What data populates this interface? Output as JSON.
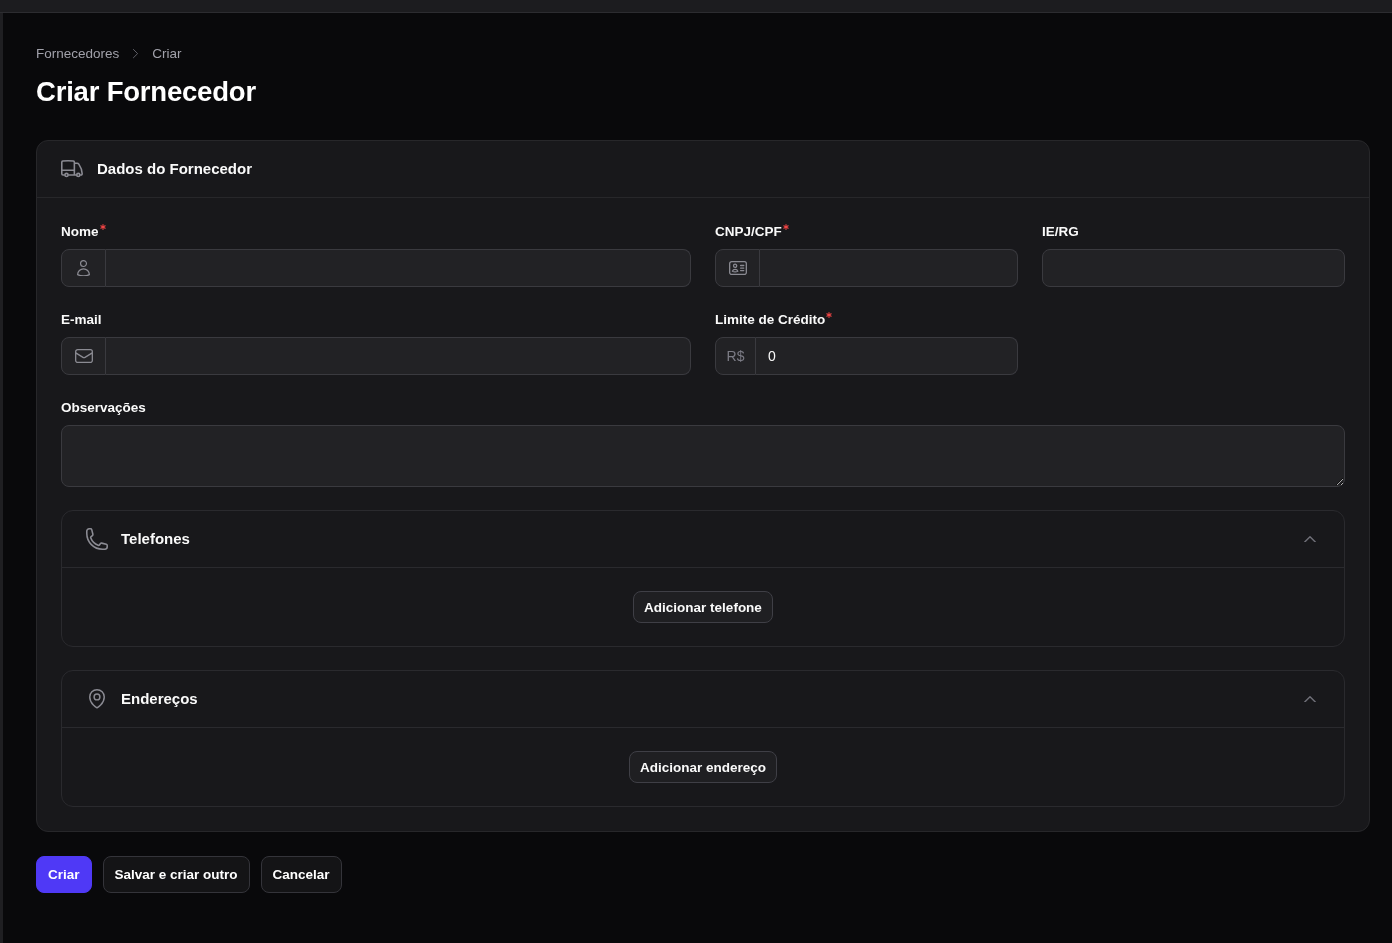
{
  "breadcrumbs": [
    "Fornecedores",
    "Criar"
  ],
  "page_title": "Criar Fornecedor",
  "card": {
    "title": "Dados do Fornecedor",
    "fields": [
      {
        "label": "Nome",
        "required": true,
        "kind": "name"
      },
      {
        "label": "CNPJ/CPF",
        "required": true,
        "kind": "document"
      },
      {
        "label": "IE/RG",
        "required": false,
        "kind": "text"
      },
      {
        "label": "E-mail",
        "required": false,
        "kind": "email"
      },
      {
        "label": "Limite de Crédito",
        "required": true,
        "kind": "money",
        "prefix": "R$",
        "value": "0"
      },
      {
        "label": "Observações",
        "required": false,
        "kind": "textarea"
      }
    ],
    "sections": [
      {
        "title": "Telefones",
        "kind": "phones",
        "expanded": true,
        "button": "Adicionar telefone"
      },
      {
        "title": "Endereços",
        "kind": "addresses",
        "expanded": true,
        "button": "Adicionar endereço"
      }
    ]
  },
  "actions": [
    {
      "label": "Criar",
      "kind": "create"
    },
    {
      "label": "Salvar e criar outro",
      "kind": "repeat"
    },
    {
      "label": "Cancelar",
      "kind": "cancel"
    }
  ]
}
